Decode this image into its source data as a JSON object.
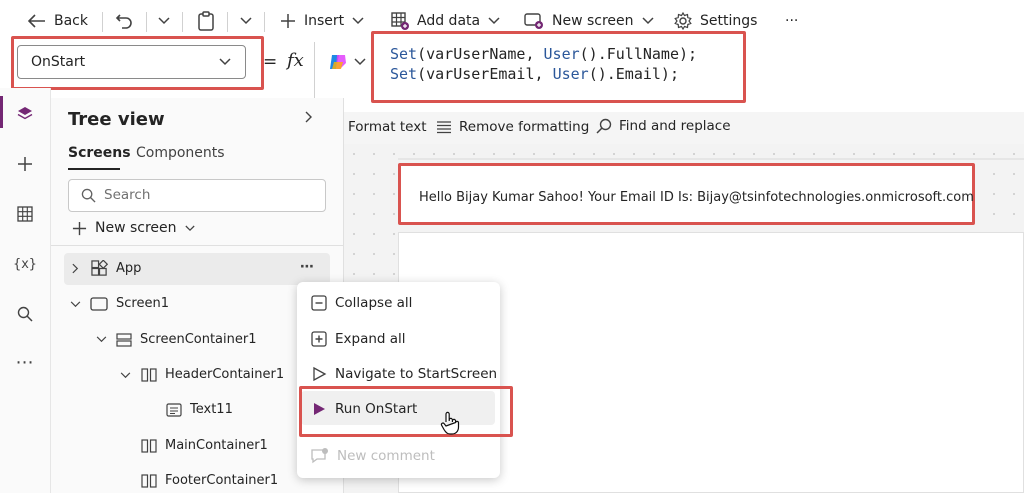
{
  "toolbar": {
    "back": "Back",
    "insert": "Insert",
    "add_data": "Add data",
    "new_screen": "New screen",
    "settings": "Settings",
    "more": "···"
  },
  "formula": {
    "property": "OnStart",
    "equals": "=",
    "fx": "fx",
    "code_line1": "Set(varUserName, User().FullName);",
    "code_line2": "Set(varUserEmail, User().Email);"
  },
  "format_bar": {
    "format_text": "Format text",
    "remove_formatting": "Remove formatting",
    "find_replace": "Find and replace"
  },
  "tree": {
    "title": "Tree view",
    "tab_screens": "Screens",
    "tab_components": "Components",
    "search_placeholder": "Search",
    "new_screen": "New screen",
    "nodes": {
      "app": "App",
      "screen1": "Screen1",
      "screen_container": "ScreenContainer1",
      "header_container": "HeaderContainer1",
      "text11": "Text11",
      "main_container": "MainContainer1",
      "footer_container": "FooterContainer1"
    }
  },
  "canvas": {
    "header_text": "Hello Bijay Kumar Sahoo! Your Email ID Is: Bijay@tsinfotechnologies.onmicrosoft.com"
  },
  "context_menu": {
    "collapse_all": "Collapse all",
    "expand_all": "Expand all",
    "navigate": "Navigate to StartScreen",
    "run_onstart": "Run OnStart",
    "new_comment": "New comment"
  },
  "colors": {
    "highlight": "#d9534f",
    "accent": "#742774",
    "tab_underline": "#242424"
  }
}
